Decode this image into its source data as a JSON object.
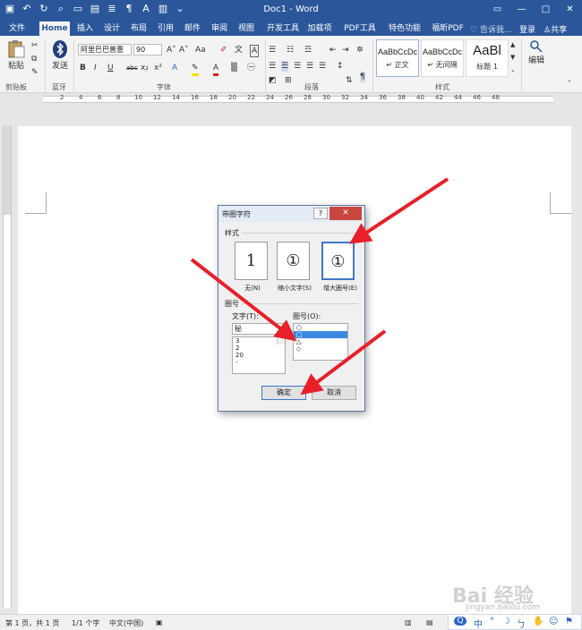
{
  "window": {
    "title": "Doc1 - Word",
    "controls": [
      "minimize",
      "maximize",
      "close"
    ]
  },
  "ribbon_tabs": [
    {
      "label": "文件",
      "active": false
    },
    {
      "label": "Home",
      "active": true
    },
    {
      "label": "插入",
      "active": false
    },
    {
      "label": "设计",
      "active": false
    },
    {
      "label": "布局",
      "active": false
    },
    {
      "label": "引用",
      "active": false
    },
    {
      "label": "邮件",
      "active": false
    },
    {
      "label": "审阅",
      "active": false
    },
    {
      "label": "视图",
      "active": false
    },
    {
      "label": "开发工具",
      "active": false
    },
    {
      "label": "加载项",
      "active": false
    },
    {
      "label": "PDF工具集",
      "active": false
    },
    {
      "label": "特色功能",
      "active": false
    },
    {
      "label": "福昕PDF",
      "active": false
    }
  ],
  "tell_me": "告诉我...",
  "account": {
    "login": "登录",
    "share": "共享"
  },
  "ribbon": {
    "clipboard": {
      "paste": "粘贴",
      "group": "剪贴板"
    },
    "bluetooth": {
      "send": "发送",
      "group": "蓝牙"
    },
    "font": {
      "name": "阿里巴巴普惠",
      "size": "90",
      "group": "字体",
      "buttons": [
        "B",
        "I",
        "U",
        "abc",
        "x₂",
        "x²",
        "A",
        "Aa",
        "A"
      ],
      "highlight_color": "#f5e000",
      "font_color": "#e02020"
    },
    "paragraph": {
      "group": "段落"
    },
    "styles": {
      "items": [
        {
          "sample": "AaBbCcDc",
          "name": "↵ 正文"
        },
        {
          "sample": "AaBbCcDc",
          "name": "↵ 无间隔"
        },
        {
          "sample": "AaBl",
          "name": "标题 1"
        }
      ],
      "group": "样式"
    },
    "editing": {
      "label": "编辑"
    }
  },
  "ruler": {
    "ticks": [
      "2",
      "4",
      "6",
      "8",
      "10",
      "12",
      "14",
      "16",
      "18",
      "20",
      "22",
      "24",
      "26",
      "28",
      "30",
      "32",
      "34",
      "36",
      "38",
      "40",
      "42",
      "44",
      "46",
      "48"
    ]
  },
  "dialog": {
    "title": "带圈字符",
    "help": "?",
    "close": "✕",
    "style_label": "样式",
    "styles": [
      {
        "glyph": "1",
        "caption": "无(N)",
        "selected": false
      },
      {
        "glyph": "①",
        "caption": "缩小文字(S)",
        "selected": false
      },
      {
        "glyph": "①",
        "caption": "增大圈号(E)",
        "selected": true
      }
    ],
    "enclosure_label": "圈号",
    "text_label": "文字(T):",
    "text_value": "秘",
    "text_list": [
      "3",
      "2",
      "20",
      "-"
    ],
    "circle_label": "圈号(O):",
    "circle_list": [
      {
        "symbol": "○",
        "selected": false
      },
      {
        "symbol": "□",
        "selected": true
      },
      {
        "symbol": "△",
        "selected": false
      },
      {
        "symbol": "◇",
        "selected": false
      }
    ],
    "ok": "确定",
    "cancel": "取消"
  },
  "statusbar": {
    "pages": "第 1 页，共 1 页",
    "words": "1/1 个字",
    "language": "中文(中国)"
  },
  "ime": {
    "items": [
      "中",
      "°",
      "☽",
      "ㄅ",
      "✋",
      "☺",
      "⚑"
    ]
  },
  "watermark": "Bai 经验",
  "watermark_url": "jingyan.baidu.com",
  "colors": {
    "word_blue": "#2b579a",
    "arrow_red": "#e8202a",
    "selection": "#3a88e0"
  }
}
